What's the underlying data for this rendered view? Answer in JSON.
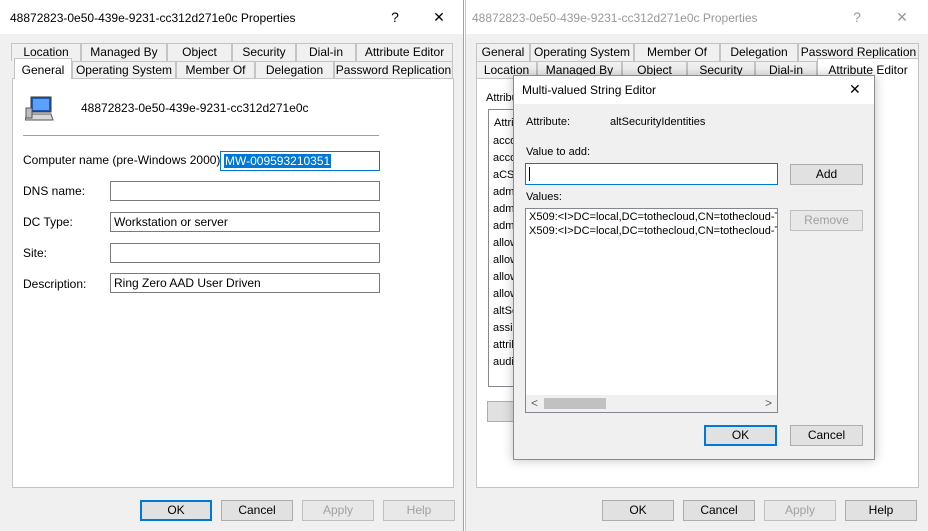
{
  "left_window": {
    "title": "48872823-0e50-439e-9231-cc312d271e0c Properties",
    "help_glyph": "?",
    "close_glyph": "✕",
    "tabs_back": [
      "Location",
      "Managed By",
      "Object",
      "Security",
      "Dial-in",
      "Attribute Editor"
    ],
    "tabs_front": [
      "General",
      "Operating System",
      "Member Of",
      "Delegation",
      "Password Replication"
    ],
    "object_name": "48872823-0e50-439e-9231-cc312d271e0c",
    "fields": {
      "computer_name": {
        "label": "Computer name (pre-Windows 2000):",
        "value": "MW-009593210351"
      },
      "dns_name": {
        "label": "DNS name:",
        "value": ""
      },
      "dc_type": {
        "label": "DC Type:",
        "value": "Workstation or server"
      },
      "site": {
        "label": "Site:",
        "value": ""
      },
      "description": {
        "label": "Description:",
        "value": "Ring Zero AAD User Driven"
      }
    },
    "buttons": {
      "ok": "OK",
      "cancel": "Cancel",
      "apply": "Apply",
      "help": "Help"
    }
  },
  "right_window": {
    "title": "48872823-0e50-439e-9231-cc312d271e0c Properties",
    "help_glyph": "?",
    "close_glyph": "✕",
    "tabs_back": [
      "General",
      "Operating System",
      "Member Of",
      "Delegation",
      "Password Replication"
    ],
    "tabs_front": [
      "Location",
      "Managed By",
      "Object",
      "Security",
      "Dial-in",
      "Attribute Editor"
    ],
    "attributes_label": "Attribu",
    "list_header": "Attrib",
    "attribute_items": [
      "acco",
      "acco",
      "aCS",
      "adm",
      "adm",
      "adm",
      "allow",
      "allow",
      "allow",
      "allow",
      "altSe",
      "assis",
      "attrib",
      "audi"
    ],
    "buttons": {
      "ok": "OK",
      "cancel": "Cancel",
      "apply": "Apply",
      "help": "Help"
    }
  },
  "dialog": {
    "title": "Multi-valued String Editor",
    "close_glyph": "✕",
    "attribute_label": "Attribute:",
    "attribute_value": "altSecurityIdentities",
    "value_to_add_label": "Value to add:",
    "value_to_add": "",
    "add_button": "Add",
    "values_label": "Values:",
    "values": [
      "X509:<I>DC=local,DC=tothecloud,CN=tothecloud-T(",
      "X509:<I>DC=local,DC=tothecloud,CN=tothecloud-T("
    ],
    "remove_button": "Remove",
    "ok_button": "OK",
    "cancel_button": "Cancel"
  }
}
